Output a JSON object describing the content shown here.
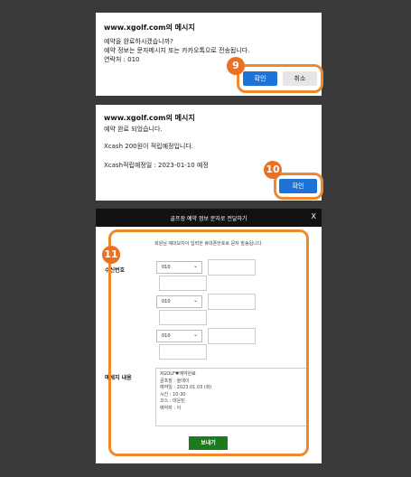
{
  "dialog1": {
    "origin": "www.xgolf.com의 메시지",
    "lines": [
      "예약을 완료하시겠습니까?",
      "예약 정보는 문자메시지 또는 카카오톡으로 전송됩니다.",
      "연락처 : 010"
    ],
    "ok_label": "확인",
    "cancel_label": "취소",
    "step_badge": "9"
  },
  "dialog2": {
    "origin": "www.xgolf.com의 메시지",
    "lines": [
      "예약 완료 되었습니다.",
      "Xcash 200원이 적립예정입니다.",
      "Xcash적립예정일 : 2023-01-10 예정"
    ],
    "ok_label": "확인",
    "step_badge": "10"
  },
  "sms_panel": {
    "title": "골프장 예약 정보 문자로 전달하기",
    "close_label": "X",
    "notice": "회원님 예대보차이 입력한 휴대폰번호로 문자 발송됩니다.",
    "step_badge": "11",
    "recipient_label": "수신번호",
    "prefix_options": [
      "010",
      "010",
      "010"
    ],
    "message_label": "메세지 내용",
    "message_lines": [
      "XGOLF♥예약완료",
      "골프장 : 올데이",
      "예약일 : 2023.01.03 (화)",
      "시간 : 10:30",
      "코스 : 마운틴",
      "예약자 : 이"
    ],
    "send_label": "보내기"
  },
  "colors": {
    "accent_blue": "#1e73d6",
    "highlight_orange": "#f0892e",
    "send_green": "#1e7a1e"
  }
}
